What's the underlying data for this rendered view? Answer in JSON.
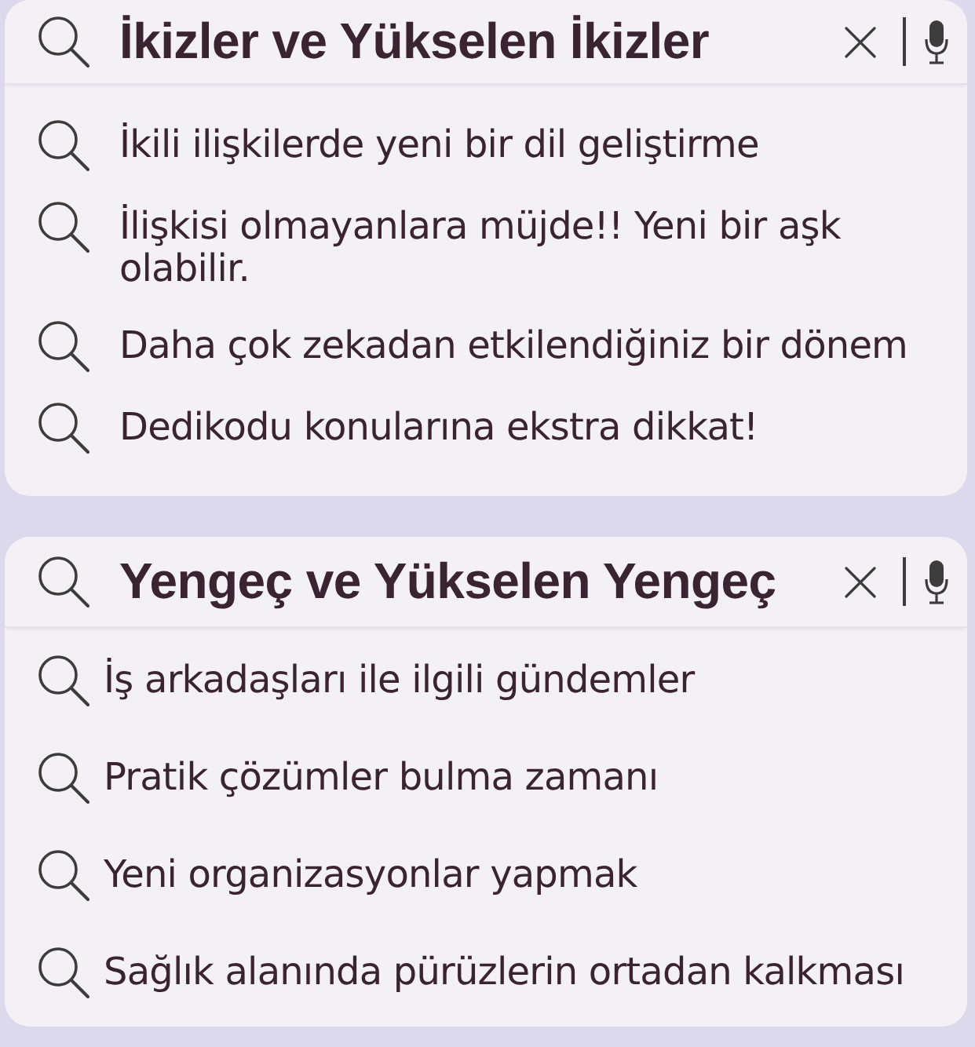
{
  "cards": [
    {
      "query": "İkizler ve Yükselen İkizler",
      "suggestions": [
        "İkili ilişkilerde yeni bir dil geliştirme",
        "İlişkisi olmayanlara müjde!! Yeni bir aşk olabilir.",
        "Daha çok zekadan etkilendiğiniz bir dönem",
        "Dedikodu konularına ekstra dikkat!"
      ]
    },
    {
      "query": "Yengeç ve Yükselen Yengeç",
      "suggestions": [
        "İş arkadaşları ile ilgili gündemler",
        "Pratik çözümler bulma zamanı",
        "Yeni organizasyonlar yapmak",
        "Sağlık alanında pürüzlerin ortadan kalkması"
      ]
    }
  ]
}
